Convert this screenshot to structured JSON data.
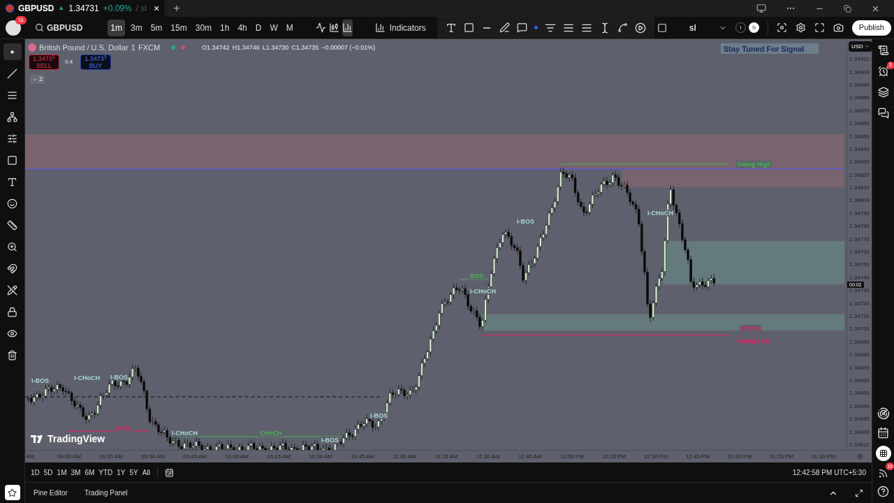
{
  "tab": {
    "symbol": "GBPUSD",
    "arrow": "▲",
    "price": "1.34731",
    "change": "+0.09%",
    "suffix": "/ sl",
    "close": "×",
    "new_tab": "+"
  },
  "toolbar": {
    "avatar_badge": "11",
    "symbol": "GBPUSD",
    "intervals": [
      {
        "label": "1m",
        "selected": true
      },
      {
        "label": "3m",
        "selected": false
      },
      {
        "label": "5m",
        "selected": false
      },
      {
        "label": "15m",
        "selected": false
      },
      {
        "label": "30m",
        "selected": false
      },
      {
        "label": "1h",
        "selected": false
      },
      {
        "label": "4h",
        "selected": false
      },
      {
        "label": "D",
        "selected": false
      },
      {
        "label": "W",
        "selected": false
      },
      {
        "label": "M",
        "selected": false
      }
    ],
    "chart_types": [
      {
        "kind": "line",
        "selected": false
      },
      {
        "kind": "candles",
        "selected": false
      },
      {
        "kind": "bars",
        "selected": true
      }
    ],
    "indicators": "Indicators",
    "layout_name": "sl",
    "circle_1": "I",
    "circle_2": "S",
    "publish": "Publish"
  },
  "left_toolbar": [
    {
      "kind": "cursor",
      "selected": true
    },
    {
      "kind": "trendline",
      "selected": false
    },
    {
      "kind": "fib",
      "selected": false
    },
    {
      "kind": "pattern",
      "selected": false
    },
    {
      "kind": "forecast",
      "selected": false
    },
    {
      "kind": "shape",
      "selected": false
    },
    {
      "kind": "text",
      "selected": false
    },
    {
      "kind": "emoji",
      "selected": false
    },
    {
      "kind": "ruler",
      "selected": false
    },
    {
      "kind": "zoom",
      "selected": false
    },
    {
      "kind": "magnet",
      "selected": false
    },
    {
      "kind": "drawmode",
      "selected": false
    },
    {
      "kind": "lock",
      "selected": false
    },
    {
      "kind": "eye",
      "selected": false
    },
    {
      "kind": "trash",
      "selected": false
    }
  ],
  "legend": {
    "name": "British Pound / U.S. Dollar",
    "interval": "1",
    "exchange": "FXCM",
    "ohlc": [
      {
        "label": "O",
        "value": "1.34742"
      },
      {
        "label": "H",
        "value": "1.34746"
      },
      {
        "label": "L",
        "value": "1.34730"
      },
      {
        "label": "C",
        "value": "1.34735"
      }
    ],
    "change": "−0.00007 (−0.01%)",
    "sell_price": "1.3473$^{5}$",
    "sell": "SELL",
    "spread": "0.4",
    "buy_price": "1.3473$^{9}$",
    "buy": "BUY",
    "collapsed_count": "2"
  },
  "signal_banner": "Stay Tuned For Signal",
  "annotations": [
    {
      "text": "I-BOS",
      "color": "#a8d8d2"
    },
    {
      "text": "I-CHoCH",
      "color": "#a8d8d2"
    },
    {
      "text": "I-BOS",
      "color": "#a8d8d2"
    },
    {
      "text": "BOS",
      "color": "#e91e63"
    },
    {
      "text": "I-CHoCH",
      "color": "#a8d8d2"
    },
    {
      "text": "CHoCH",
      "color": "#4caf50"
    },
    {
      "text": "I-BOS",
      "color": "#a8d8d2"
    },
    {
      "text": "I-BOS",
      "color": "#a8d8d2"
    },
    {
      "text": "BOS",
      "color": "#4caf50"
    },
    {
      "text": "I-CHoCH",
      "color": "#a8d8d2"
    },
    {
      "text": "I-BOS",
      "color": "#a8d8d2"
    },
    {
      "text": "I-CHoCH",
      "color": "#a8d8d2"
    },
    {
      "text": "Swing High",
      "color": "#4caf50"
    },
    {
      "text": "Strong",
      "color": "#e91e63"
    },
    {
      "text": "Swing Low",
      "color": "#e91e63"
    }
  ],
  "watermark_logo": "TradingView",
  "price_axis": {
    "currency": "USD",
    "labels": [
      "1.34910",
      "1.34900",
      "1.34890",
      "1.34880",
      "1.34870",
      "1.34860",
      "1.34850",
      "1.34840",
      "1.34830",
      "1.34820",
      "1.34810",
      "1.34800",
      "1.34790",
      "1.34780",
      "1.34770",
      "1.34760",
      "1.34750",
      "1.34740",
      "1.34730",
      "1.34720",
      "1.34710",
      "1.34700",
      "1.34690",
      "1.34680",
      "1.34670",
      "1.34660",
      "1.34650",
      "1.34640",
      "1.34630",
      "1.34620",
      "1.34610"
    ],
    "countdown": "00:02"
  },
  "time_axis": [
    "AM",
    "09:00 AM",
    "09:15 AM",
    "09:30 AM",
    "09:45 AM",
    "10:00 AM",
    "10:15 AM",
    "10:30 AM",
    "10:45 AM",
    "11:00 AM",
    "11:15 AM",
    "11:30 AM",
    "11:45 AM",
    "12:00 PM",
    "12:15 PM",
    "12:30 PM",
    "12:45 PM",
    "01:00 PM",
    "01:15 PM",
    "01:30 PM"
  ],
  "ranges": [
    "1D",
    "5D",
    "1M",
    "3M",
    "6M",
    "YTD",
    "1Y",
    "5Y",
    "All"
  ],
  "clock": "12:42:58 PM UTC+5:30",
  "bottom_tabs": [
    "Pine Editor",
    "Trading Panel"
  ],
  "right_sidebar": {
    "alerts_badge": "5",
    "news_badge": "19"
  }
}
